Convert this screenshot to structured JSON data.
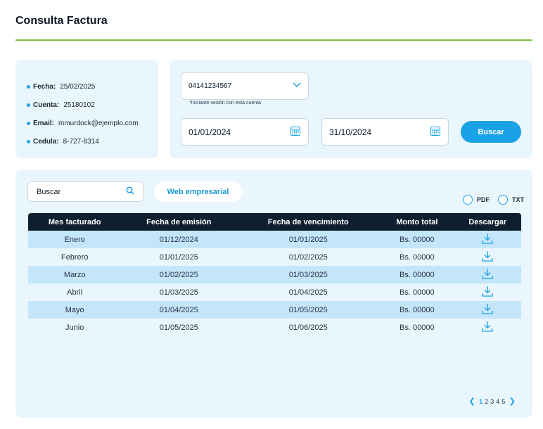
{
  "page": {
    "title": "Consulta Factura"
  },
  "colors": {
    "accent": "#1aa2e6",
    "rule": "#7cc242",
    "header_bg": "#0e2030",
    "card_bg": "#eaf6fd",
    "row_alt": "#c4e6fb"
  },
  "info": [
    {
      "label": "Fecha:",
      "value": "25/02/2025"
    },
    {
      "label": "Cuenta:",
      "value": "25180102"
    },
    {
      "label": "Email:",
      "value": "mmurdock@ejemplo.com"
    },
    {
      "label": "Cedula:",
      "value": "8-727-8314"
    }
  ],
  "filters": {
    "account_value": "04141234567",
    "account_hint": "*Iniciaste sesión con esta cuenta",
    "date_from": "01/01/2024",
    "date_to": "31/10/2024",
    "search_button": "Buscar"
  },
  "toolbar": {
    "search_placeholder": "Buscar",
    "web_button": "Web empresarial",
    "format_pdf": "PDF",
    "format_txt": "TXT"
  },
  "table": {
    "columns": [
      "Mes facturado",
      "Fecha de emisión",
      "Fecha de vencimiento",
      "Monto total",
      "Descargar"
    ],
    "rows": [
      [
        "Enero",
        "01/12/2024",
        "01/01/2025",
        "Bs. 00000"
      ],
      [
        "Febrero",
        "01/01/2025",
        "01/02/2025",
        "Bs. 00000"
      ],
      [
        "Marzo",
        "01/02/2025",
        "01/03/2025",
        "Bs. 00000"
      ],
      [
        "Abril",
        "01/03/2025",
        "01/04/2025",
        "Bs. 00000"
      ],
      [
        "Mayo",
        "01/04/2025",
        "01/05/2025",
        "Bs. 00000"
      ],
      [
        "Junio",
        "01/05/2025",
        "01/06/2025",
        "Bs. 00000"
      ]
    ],
    "download_icon": "download-icon"
  },
  "pagination": {
    "pages": [
      "1",
      "2",
      "3",
      "4",
      "5"
    ],
    "current": "1"
  }
}
